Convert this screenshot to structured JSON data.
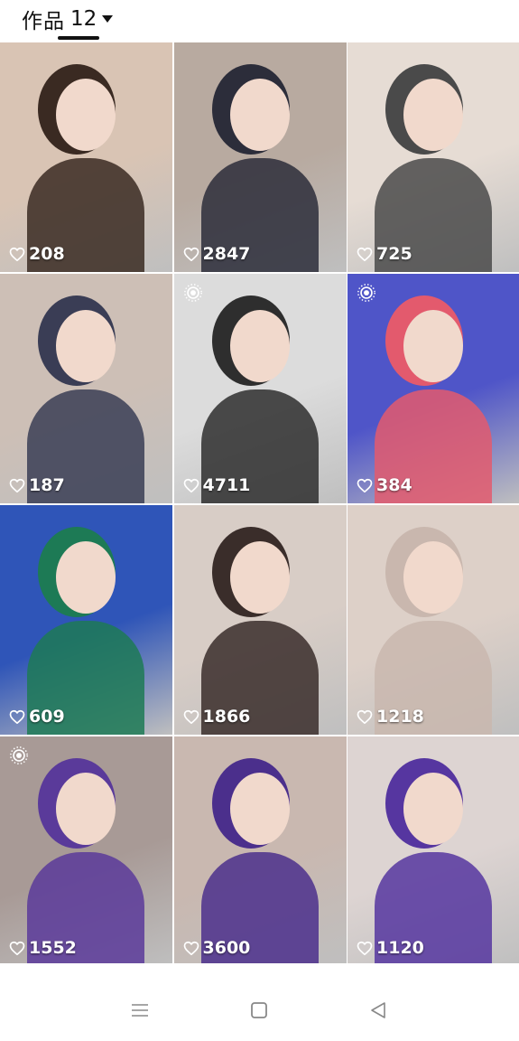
{
  "header": {
    "tab_label": "作品",
    "tab_count": "12"
  },
  "posts": [
    {
      "likes": "208",
      "live": false,
      "bg": "#d9c4b4",
      "accent": "#3a2a22"
    },
    {
      "likes": "2847",
      "live": false,
      "bg": "#b8aaa0",
      "accent": "#2c2d3a"
    },
    {
      "likes": "725",
      "live": false,
      "bg": "#e6dcd4",
      "accent": "#4a4a4a"
    },
    {
      "likes": "187",
      "live": false,
      "bg": "#cdbfb6",
      "accent": "#3a3d55"
    },
    {
      "likes": "4711",
      "live": true,
      "bg": "#dcdcdc",
      "accent": "#2e2e2e"
    },
    {
      "likes": "384",
      "live": true,
      "bg": "#4f55c8",
      "accent": "#e35a6d"
    },
    {
      "likes": "609",
      "live": false,
      "bg": "#2f55b8",
      "accent": "#1d7a55"
    },
    {
      "likes": "1866",
      "live": false,
      "bg": "#d8cdc6",
      "accent": "#3a2d2a"
    },
    {
      "likes": "1218",
      "live": false,
      "bg": "#ddd0c8",
      "accent": "#c9b7ae"
    },
    {
      "likes": "1552",
      "live": true,
      "bg": "#a89a96",
      "accent": "#5a3a9a"
    },
    {
      "likes": "3600",
      "live": false,
      "bg": "#c9b8b0",
      "accent": "#4b2f8c"
    },
    {
      "likes": "1120",
      "live": false,
      "bg": "#ddd4d2",
      "accent": "#5636a0"
    }
  ],
  "icons": {
    "like": "heart-outline-icon",
    "live": "live-photo-icon",
    "nav_menu": "menu-icon",
    "nav_home": "home-square-icon",
    "nav_back": "back-triangle-icon"
  }
}
